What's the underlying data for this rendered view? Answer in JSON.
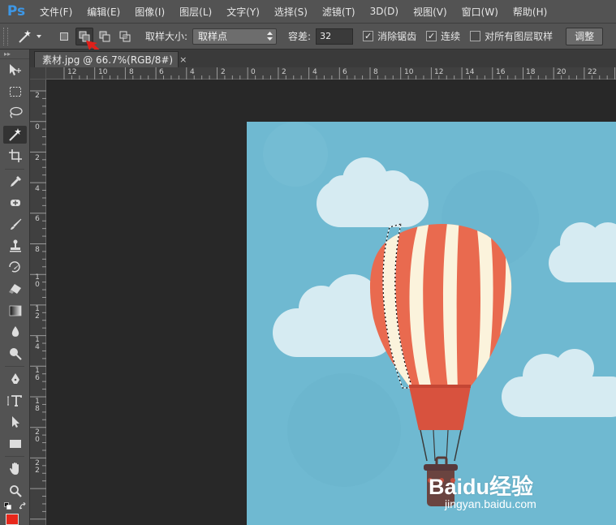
{
  "app": {
    "logo": "Ps"
  },
  "menu": [
    "文件(F)",
    "编辑(E)",
    "图像(I)",
    "图层(L)",
    "文字(Y)",
    "选择(S)",
    "滤镜(T)",
    "3D(D)",
    "视图(V)",
    "窗口(W)",
    "帮助(H)"
  ],
  "options": {
    "tool_icon": "magic-wand-icon",
    "selection_modes": [
      {
        "name": "new-selection",
        "active": false
      },
      {
        "name": "add-to-selection",
        "active": true
      },
      {
        "name": "subtract-from-selection",
        "active": false
      },
      {
        "name": "intersect-with-selection",
        "active": false
      }
    ],
    "sample_size_label": "取样大小:",
    "sample_size_value": "取样点",
    "tolerance_label": "容差:",
    "tolerance_value": "32",
    "anti_alias_label": "消除锯齿",
    "anti_alias_checked": true,
    "contiguous_label": "连续",
    "contiguous_checked": true,
    "sample_all_label": "对所有图层取样",
    "sample_all_checked": false,
    "refine_edge_label": "调整"
  },
  "document": {
    "tab_title": "素材.jpg @ 66.7%(RGB/8#)",
    "close_glyph": "×"
  },
  "rulers": {
    "horizontal": [
      "12",
      "10",
      "8",
      "6",
      "4",
      "2",
      "0",
      "2",
      "4",
      "6",
      "8",
      "10",
      "12",
      "14",
      "16",
      "18",
      "20",
      "22"
    ],
    "vertical": [
      "2",
      "0",
      "2",
      "4",
      "6",
      "8",
      "10",
      "12",
      "14",
      "16",
      "18",
      "20",
      "22"
    ]
  },
  "tools": [
    "move-icon",
    "marquee-icon",
    "lasso-icon",
    "magic-wand-icon",
    "crop-icon",
    "eyedropper-icon",
    "healing-brush-icon",
    "brush-icon",
    "clone-stamp-icon",
    "history-brush-icon",
    "eraser-icon",
    "gradient-icon",
    "blur-icon",
    "dodge-icon",
    "pen-icon",
    "type-icon",
    "path-selection-icon",
    "rectangle-icon",
    "hand-icon",
    "zoom-icon"
  ],
  "active_tool": "magic-wand-icon",
  "colors": {
    "foreground": "#e8271b",
    "sky": "#6fb9d1",
    "balloon_red": "#e66a4f",
    "balloon_cream": "#fbf3dc",
    "app_panel": "#535353",
    "ps_blue": "#3d97e6"
  },
  "watermark": {
    "logo_text": "Baidu经验",
    "url": "jingyan.baidu.com"
  }
}
